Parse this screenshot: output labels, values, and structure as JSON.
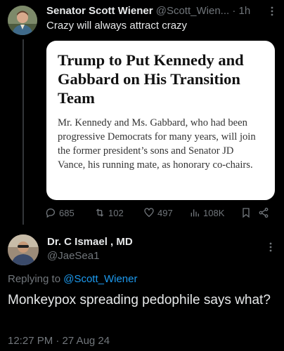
{
  "tweet1": {
    "name": "Senator Scott Wiener",
    "handle": "@Scott_Wien...",
    "separator": "·",
    "time": "1h",
    "text": "Crazy will always attract crazy",
    "card": {
      "headline": "Trump to Put Kennedy and Gabbard on His Transition Team",
      "body": "Mr. Kennedy and Ms. Gabbard, who had been progressive Democrats for many years, will join the former president’s sons and Senator JD Vance, his running mate, as honorary co-chairs."
    },
    "actions": {
      "replies": "685",
      "retweets": "102",
      "likes": "497",
      "views": "108K"
    }
  },
  "tweet2": {
    "name": "Dr. C Ismael , MD",
    "handle": "@JaeSea1",
    "replying_prefix": "Replying to ",
    "replying_to": "@Scott_Wiener",
    "text": "Monkeypox spreading pedophile says what?",
    "timestamp": "12:27 PM · 27 Aug 24"
  },
  "icons": {
    "reply": "reply-icon",
    "retweet": "retweet-icon",
    "like": "heart-icon",
    "views": "views-icon",
    "bookmark": "bookmark-icon",
    "share": "share-icon",
    "more": "more-icon"
  },
  "colors": {
    "background": "#000000",
    "text": "#e7e9ea",
    "muted": "#71767b",
    "link": "#1d9bf0",
    "card_bg": "#ffffff"
  }
}
